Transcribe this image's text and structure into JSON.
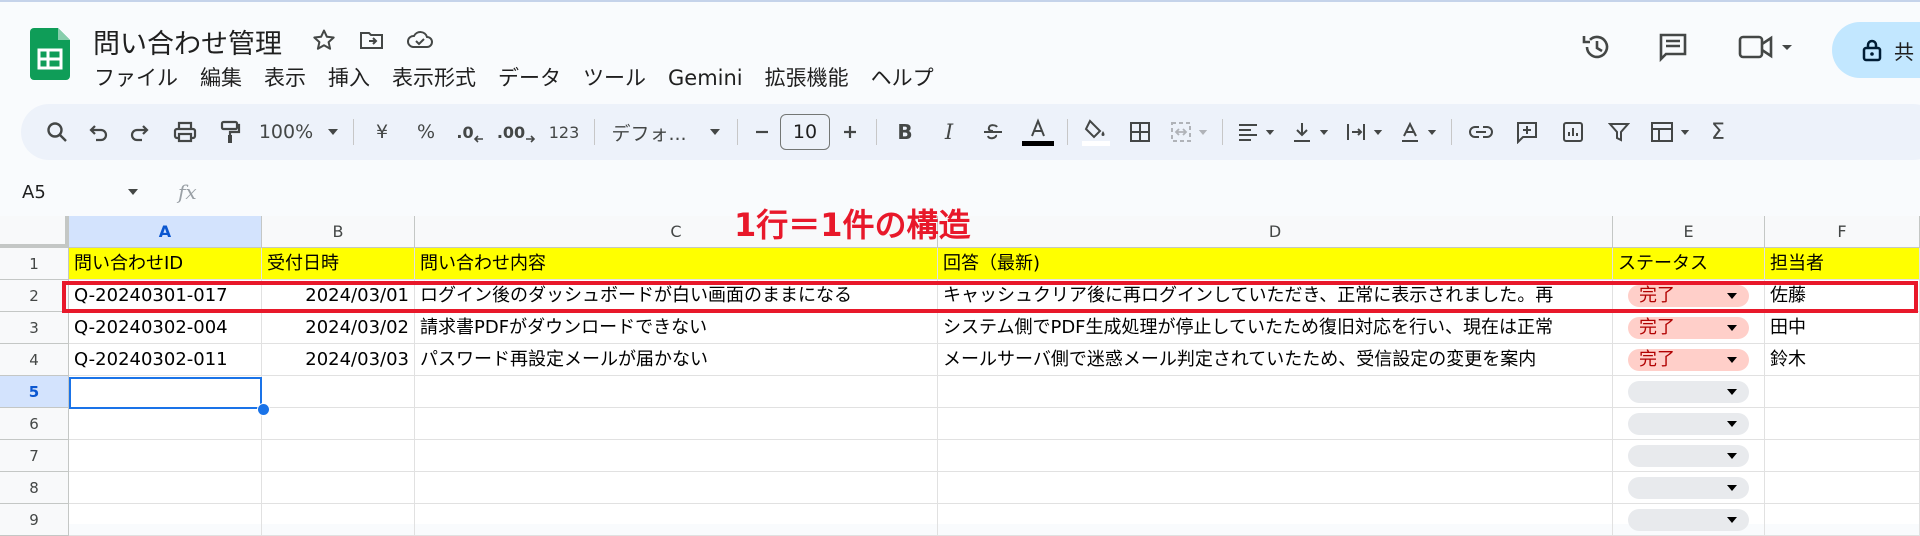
{
  "app": {
    "doc_title": "問い合わせ管理",
    "brand_color": "#0f9d58",
    "menu": [
      "ファイル",
      "編集",
      "表示",
      "挿入",
      "表示形式",
      "データ",
      "ツール",
      "Gemini",
      "拡張機能",
      "ヘルプ"
    ],
    "share_label": "共"
  },
  "toolbar": {
    "zoom": "100%",
    "currency": "¥",
    "percent": "%",
    "decimal_decrease": ".0",
    "decimal_increase": ".00",
    "number_format": "123",
    "font": "デフォ...",
    "font_size": "10",
    "bold": "B",
    "italic": "I"
  },
  "formula_bar": {
    "name_box": "A5",
    "fx_label": "fx"
  },
  "annotation": "1行＝1件の構造",
  "sheet": {
    "columns": [
      "A",
      "B",
      "C",
      "D",
      "E",
      "F"
    ],
    "row_numbers": [
      "1",
      "2",
      "3",
      "4",
      "5",
      "6",
      "7",
      "8",
      "9"
    ],
    "header_row": [
      "問い合わせID",
      "受付日時",
      "問い合わせ内容",
      "回答（最新)",
      "ステータス",
      "担当者"
    ],
    "rows": [
      {
        "id": "Q-20240301-017",
        "date": "2024/03/01",
        "content": "ログイン後のダッシュボードが白い画面のままになる",
        "answer": "キャッシュクリア後に再ログインしていただき、正常に表示されました。再",
        "status": "完了",
        "owner": "佐藤"
      },
      {
        "id": "Q-20240302-004",
        "date": "2024/03/02",
        "content": "請求書PDFがダウンロードできない",
        "answer": "システム側でPDF生成処理が停止していたため復旧対応を行い、現在は正常",
        "status": "完了",
        "owner": "田中"
      },
      {
        "id": "Q-20240302-011",
        "date": "2024/03/03",
        "content": "パスワード再設定メールが届かない",
        "answer": "メールサーバ側で迷惑メール判定されていたため、受信設定の変更を案内",
        "status": "完了",
        "owner": "鈴木"
      }
    ],
    "selected_cell": "A5",
    "header_fill": "#ffff00",
    "status_done_color": "#ffcfc9",
    "highlight_color": "#e8182a"
  }
}
